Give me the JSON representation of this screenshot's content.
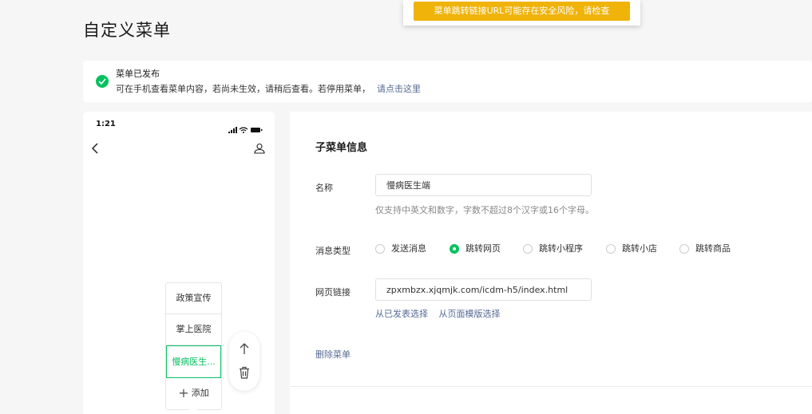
{
  "page": {
    "title": "自定义菜单"
  },
  "toast": {
    "message": "菜单跳转链接URL可能存在安全风险，请检查"
  },
  "notice": {
    "title": "菜单已发布",
    "description": "可在手机查看菜单内容，若尚未生效，请稍后查看。若停用菜单，",
    "link": "请点击这里"
  },
  "phone": {
    "time": "1:21",
    "submenu": {
      "items": [
        {
          "label": "政策宣传"
        },
        {
          "label": "掌上医院"
        },
        {
          "label": "慢病医生..."
        }
      ],
      "add_label": "添加"
    }
  },
  "panel": {
    "title": "子菜单信息",
    "name_label": "名称",
    "name_value": "慢病医生端",
    "name_hint": "仅支持中英文和数字，字数不超过8个汉字或16个字母。",
    "type_label": "消息类型",
    "type_options": [
      {
        "label": "发送消息",
        "checked": false
      },
      {
        "label": "跳转网页",
        "checked": true
      },
      {
        "label": "跳转小程序",
        "checked": false
      },
      {
        "label": "跳转小店",
        "checked": false
      },
      {
        "label": "跳转商品",
        "checked": false
      }
    ],
    "url_label": "网页链接",
    "url_value": "zpxmbzx.xjqmjk.com/icdm-h5/index.html",
    "link_published": "从已发表选择",
    "link_template": "从页面模版选择",
    "delete_label": "删除菜单"
  },
  "colors": {
    "accent": "#07c160",
    "link": "#576b95",
    "warning": "#efb30a"
  }
}
